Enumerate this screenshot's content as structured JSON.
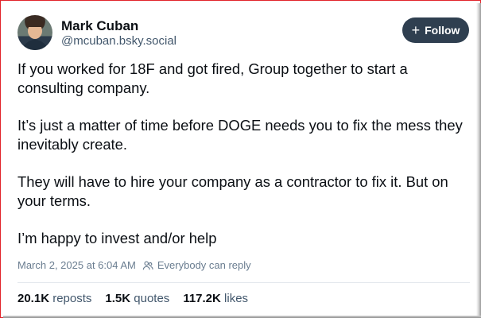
{
  "author": {
    "name": "Mark Cuban",
    "handle": "@mcuban.bsky.social"
  },
  "follow_button": {
    "label": "Follow",
    "icon": "plus-icon"
  },
  "post": {
    "paragraphs": [
      "If you worked for 18F and got fired, Group together to start a consulting company.",
      "It’s just a matter of time before DOGE needs you to fix the mess they inevitably create.",
      "They will have to hire your company as a contractor to fix it. But on your terms.",
      "I’m happy to invest and/or help"
    ]
  },
  "meta": {
    "timestamp": "March 2, 2025 at 6:04 AM",
    "reply_setting": "Everybody can reply"
  },
  "stats": {
    "reposts_count": "20.1K",
    "reposts_label": "reposts",
    "quotes_count": "1.5K",
    "quotes_label": "quotes",
    "likes_count": "117.2K",
    "likes_label": "likes"
  },
  "colors": {
    "frame_border": "#e2242a",
    "button_bg": "#2f3f50",
    "muted_text": "#42576c"
  }
}
